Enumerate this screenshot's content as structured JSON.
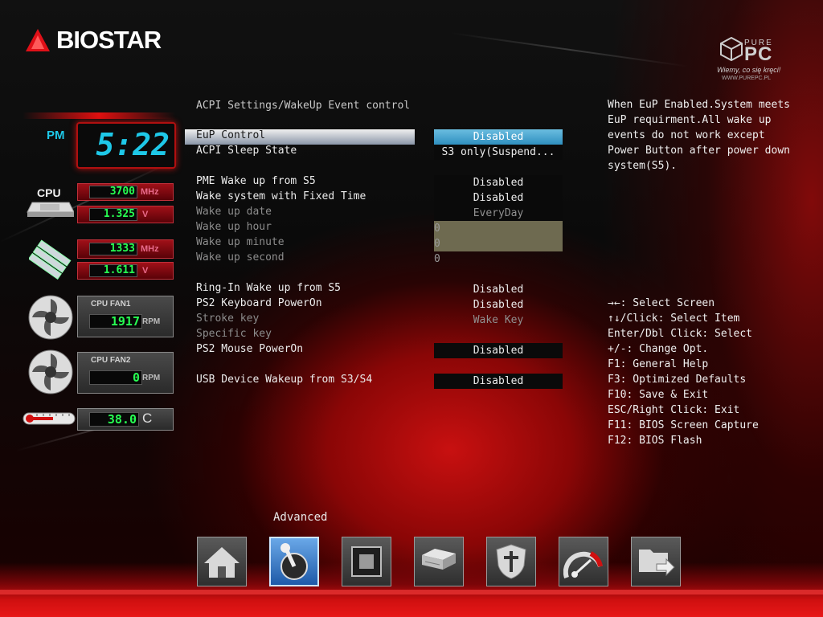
{
  "brand": {
    "logo": "BIOSTAR",
    "watermark_top": "PURE",
    "watermark_big": "PC",
    "watermark_slogan": "Wiemy, co się kręci!",
    "watermark_url": "WWW.PUREPC.PL"
  },
  "left_panel": {
    "clock": {
      "ampm": "PM",
      "time": "5:22"
    },
    "cpu": {
      "label": "CPU",
      "freq": "3700",
      "freq_unit": "MHz",
      "volt": "1.325",
      "volt_unit": "V"
    },
    "memory": {
      "freq": "1333",
      "freq_unit": "MHz",
      "volt": "1.611",
      "volt_unit": "V"
    },
    "cpu_fan1": {
      "label": "CPU FAN1",
      "rpm": "1917",
      "unit": "RPM"
    },
    "cpu_fan2": {
      "label": "CPU FAN2",
      "rpm": "0",
      "unit": "RPM"
    },
    "temperature": {
      "value": "38.0",
      "unit": "C"
    }
  },
  "page": {
    "title": "ACPI Settings/WakeUp Event control",
    "rows": [
      {
        "label": "EuP Control",
        "value": "Disabled"
      },
      {
        "label": "ACPI Sleep State",
        "value": "S3 only(Suspend..."
      },
      {
        "label": "PME Wake up from S5",
        "value": "Disabled"
      },
      {
        "label": "Wake system with Fixed Time",
        "value": "Disabled"
      },
      {
        "label": "Wake up date",
        "value": "EveryDay"
      },
      {
        "label": "Wake up hour",
        "value": "0"
      },
      {
        "label": "Wake up minute",
        "value": "0"
      },
      {
        "label": "Wake up second",
        "value": "0"
      },
      {
        "label": "Ring-In Wake up from S5",
        "value": "Disabled"
      },
      {
        "label": "PS2 Keyboard PowerOn",
        "value": "Disabled"
      },
      {
        "label": "Stroke key",
        "value": "Wake Key"
      },
      {
        "label": "Specific key",
        "value": ""
      },
      {
        "label": "PS2 Mouse PowerOn",
        "value": "Disabled"
      },
      {
        "label": "USB Device Wakeup from S3/S4",
        "value": "Disabled"
      }
    ]
  },
  "help": {
    "description": [
      "When EuP Enabled.System meets",
      "EuP requirment.All wake up",
      "events do not work except",
      "Power Button after power down",
      "system(S5)."
    ],
    "keys": [
      "→←: Select Screen",
      "↑↓/Click: Select Item",
      "Enter/Dbl Click: Select",
      "+/-: Change Opt.",
      "F1: General Help",
      "F3: Optimized Defaults",
      "F10: Save & Exit",
      "ESC/Right Click: Exit",
      "F11: BIOS Screen Capture",
      "F12: BIOS Flash"
    ]
  },
  "nav": {
    "active_label": "Advanced",
    "items": [
      "home-icon",
      "advanced-joystick-icon",
      "chipset-icon",
      "storage-icon",
      "security-icon",
      "performance-gauge-icon",
      "exit-folder-icon"
    ]
  },
  "colors": {
    "selected_value": "#2f8fbf",
    "lcd_green": "#27ff52",
    "accent_red": "#d01010"
  }
}
